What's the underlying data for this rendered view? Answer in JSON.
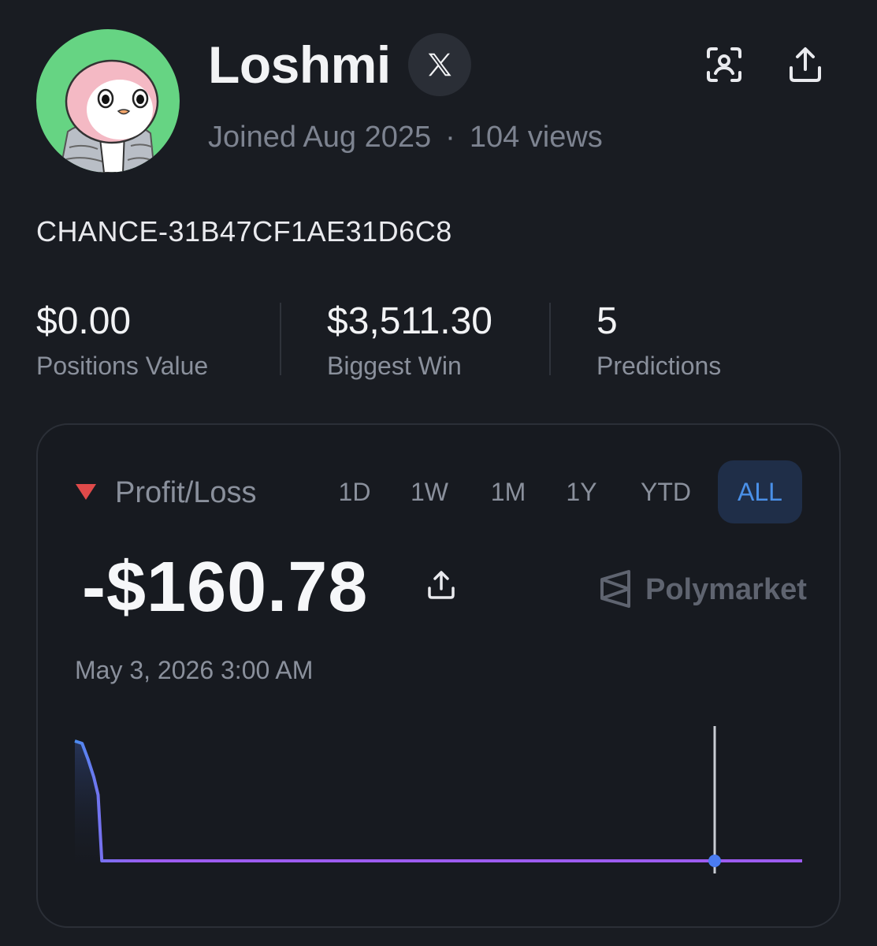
{
  "profile": {
    "name": "Loshmi",
    "joined": "Joined Aug 2025",
    "separator": "·",
    "views": "104 views",
    "chance_id": "CHANCE-31B47CF1AE31D6C8"
  },
  "stats": [
    {
      "value": "$0.00",
      "label": "Positions Value"
    },
    {
      "value": "$3,511.30",
      "label": "Biggest Win"
    },
    {
      "value": "5",
      "label": "Predictions"
    }
  ],
  "pnl_card": {
    "label": "Profit/Loss",
    "tabs": [
      "1D",
      "1W",
      "1M",
      "1Y",
      "YTD",
      "ALL"
    ],
    "active_tab": "ALL",
    "value": "-$160.78",
    "source": "Polymarket",
    "date": "May 3, 2026 3:00 AM"
  },
  "colors": {
    "background": "#191c22",
    "accent_blue": "#4a90e8",
    "line_purple": "#9c5cf0",
    "loss_red": "#e04a4a",
    "avatar_green": "#66d483"
  },
  "icons": {
    "x": "x-logo-icon",
    "scan": "scan-profile-icon",
    "share": "share-icon",
    "down": "down-triangle-icon",
    "source": "polymarket-logo-icon"
  },
  "chart_data": {
    "type": "line",
    "title": "",
    "xlabel": "",
    "ylabel": "",
    "grid": false,
    "series": [
      {
        "values": [
          100,
          98,
          85,
          70,
          55,
          0,
          0,
          0,
          0,
          0,
          0,
          0,
          0,
          0,
          0,
          0
        ]
      }
    ],
    "cursor_index": 14
  }
}
